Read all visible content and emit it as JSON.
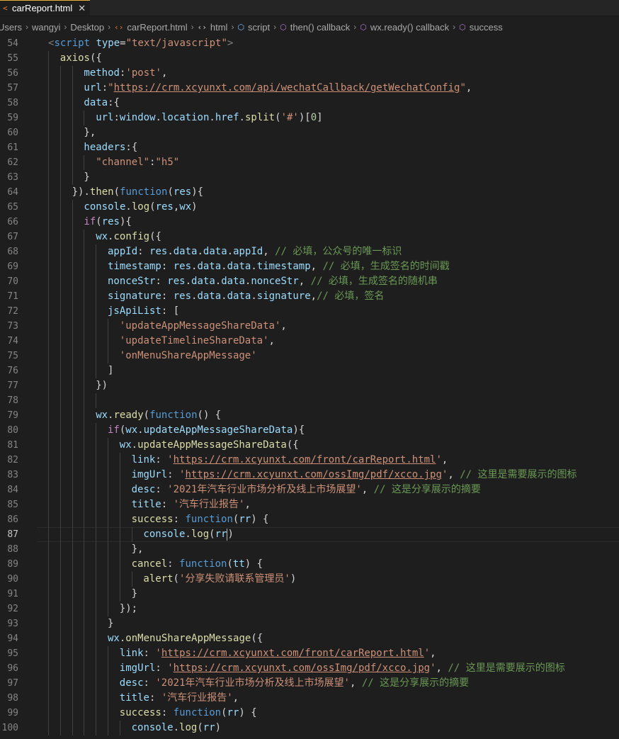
{
  "tab": {
    "title": "carReport.html",
    "icon": "html-file-icon",
    "close": "✕"
  },
  "breadcrumb": [
    {
      "label": "Users",
      "icon": null
    },
    {
      "label": "wangyi",
      "icon": null
    },
    {
      "label": "Desktop",
      "icon": null
    },
    {
      "label": "carReport.html",
      "icon": "html-file-icon"
    },
    {
      "label": "html",
      "icon": "tag-icon"
    },
    {
      "label": "script",
      "icon": "symbol-cube-icon"
    },
    {
      "label": "then() callback",
      "icon": "symbol-method-icon"
    },
    {
      "label": "wx.ready() callback",
      "icon": "symbol-method-icon"
    },
    {
      "label": "success",
      "icon": "symbol-method-icon"
    }
  ],
  "editor": {
    "active_line": 87,
    "lines": [
      {
        "n": 54,
        "indent": 1,
        "tokens": [
          [
            "tagp",
            "<"
          ],
          [
            "tag",
            "script"
          ],
          [
            "pun",
            " "
          ],
          [
            "attr",
            "type"
          ],
          [
            "pun",
            "="
          ],
          [
            "str",
            "\"text/javascript\""
          ],
          [
            "tagp",
            ">"
          ]
        ]
      },
      {
        "n": 55,
        "indent": 2,
        "tokens": [
          [
            "fn",
            "axios"
          ],
          [
            "pun",
            "({"
          ]
        ]
      },
      {
        "n": 56,
        "indent": 4,
        "tokens": [
          [
            "var",
            "method"
          ],
          [
            "pun",
            ":"
          ],
          [
            "str",
            "'post'"
          ],
          [
            "pun",
            ","
          ]
        ]
      },
      {
        "n": 57,
        "indent": 4,
        "tokens": [
          [
            "var",
            "url"
          ],
          [
            "pun",
            ":"
          ],
          [
            "str",
            "\""
          ],
          [
            "url",
            "https://crm.xcyunxt.com/api/wechatCallback/getWechatConfig"
          ],
          [
            "str",
            "\""
          ],
          [
            "pun",
            ","
          ]
        ]
      },
      {
        "n": 58,
        "indent": 4,
        "tokens": [
          [
            "var",
            "data"
          ],
          [
            "pun",
            ":{"
          ]
        ]
      },
      {
        "n": 59,
        "indent": 5,
        "tokens": [
          [
            "var",
            "url"
          ],
          [
            "pun",
            ":"
          ],
          [
            "var",
            "window"
          ],
          [
            "pun",
            "."
          ],
          [
            "var",
            "location"
          ],
          [
            "pun",
            "."
          ],
          [
            "var",
            "href"
          ],
          [
            "pun",
            "."
          ],
          [
            "fn",
            "split"
          ],
          [
            "pun",
            "("
          ],
          [
            "str",
            "'#'"
          ],
          [
            "pun",
            ")["
          ],
          [
            "num",
            "0"
          ],
          [
            "pun",
            "]"
          ]
        ]
      },
      {
        "n": 60,
        "indent": 4,
        "tokens": [
          [
            "pun",
            "},"
          ]
        ]
      },
      {
        "n": 61,
        "indent": 4,
        "tokens": [
          [
            "var",
            "headers"
          ],
          [
            "pun",
            ":{"
          ]
        ]
      },
      {
        "n": 62,
        "indent": 5,
        "tokens": [
          [
            "str",
            "\"channel\""
          ],
          [
            "pun",
            ":"
          ],
          [
            "str",
            "\"h5\""
          ]
        ]
      },
      {
        "n": 63,
        "indent": 4,
        "tokens": [
          [
            "pun",
            "}"
          ]
        ]
      },
      {
        "n": 64,
        "indent": 3,
        "tokens": [
          [
            "pun",
            "})."
          ],
          [
            "fn",
            "then"
          ],
          [
            "pun",
            "("
          ],
          [
            "kw",
            "function"
          ],
          [
            "pun",
            "("
          ],
          [
            "var",
            "res"
          ],
          [
            "pun",
            "){"
          ]
        ]
      },
      {
        "n": 65,
        "indent": 4,
        "tokens": [
          [
            "var",
            "console"
          ],
          [
            "pun",
            "."
          ],
          [
            "fn",
            "log"
          ],
          [
            "pun",
            "("
          ],
          [
            "var",
            "res"
          ],
          [
            "pun",
            ","
          ],
          [
            "var",
            "wx"
          ],
          [
            "pun",
            ")"
          ]
        ]
      },
      {
        "n": 66,
        "indent": 4,
        "tokens": [
          [
            "ctrl",
            "if"
          ],
          [
            "pun",
            "("
          ],
          [
            "var",
            "res"
          ],
          [
            "pun",
            "){"
          ]
        ]
      },
      {
        "n": 67,
        "indent": 5,
        "tokens": [
          [
            "var",
            "wx"
          ],
          [
            "pun",
            "."
          ],
          [
            "fn",
            "config"
          ],
          [
            "pun",
            "({"
          ]
        ]
      },
      {
        "n": 68,
        "indent": 6,
        "tokens": [
          [
            "var",
            "appId"
          ],
          [
            "pun",
            ": "
          ],
          [
            "var",
            "res"
          ],
          [
            "pun",
            "."
          ],
          [
            "var",
            "data"
          ],
          [
            "pun",
            "."
          ],
          [
            "var",
            "data"
          ],
          [
            "pun",
            "."
          ],
          [
            "var",
            "appId"
          ],
          [
            "pun",
            ", "
          ],
          [
            "cmt",
            "// 必填，公众号的唯一标识"
          ]
        ]
      },
      {
        "n": 69,
        "indent": 6,
        "tokens": [
          [
            "var",
            "timestamp"
          ],
          [
            "pun",
            ": "
          ],
          [
            "var",
            "res"
          ],
          [
            "pun",
            "."
          ],
          [
            "var",
            "data"
          ],
          [
            "pun",
            "."
          ],
          [
            "var",
            "data"
          ],
          [
            "pun",
            "."
          ],
          [
            "var",
            "timestamp"
          ],
          [
            "pun",
            ", "
          ],
          [
            "cmt",
            "// 必填，生成签名的时间戳"
          ]
        ]
      },
      {
        "n": 70,
        "indent": 6,
        "tokens": [
          [
            "var",
            "nonceStr"
          ],
          [
            "pun",
            ": "
          ],
          [
            "var",
            "res"
          ],
          [
            "pun",
            "."
          ],
          [
            "var",
            "data"
          ],
          [
            "pun",
            "."
          ],
          [
            "var",
            "data"
          ],
          [
            "pun",
            "."
          ],
          [
            "var",
            "nonceStr"
          ],
          [
            "pun",
            ", "
          ],
          [
            "cmt",
            "// 必填，生成签名的随机串"
          ]
        ]
      },
      {
        "n": 71,
        "indent": 6,
        "tokens": [
          [
            "var",
            "signature"
          ],
          [
            "pun",
            ": "
          ],
          [
            "var",
            "res"
          ],
          [
            "pun",
            "."
          ],
          [
            "var",
            "data"
          ],
          [
            "pun",
            "."
          ],
          [
            "var",
            "data"
          ],
          [
            "pun",
            "."
          ],
          [
            "var",
            "signature"
          ],
          [
            "pun",
            ","
          ],
          [
            "cmt",
            "// 必填，签名"
          ]
        ]
      },
      {
        "n": 72,
        "indent": 6,
        "tokens": [
          [
            "var",
            "jsApiList"
          ],
          [
            "pun",
            ": ["
          ]
        ]
      },
      {
        "n": 73,
        "indent": 7,
        "tokens": [
          [
            "str",
            "'updateAppMessageShareData'"
          ],
          [
            "pun",
            ","
          ]
        ]
      },
      {
        "n": 74,
        "indent": 7,
        "tokens": [
          [
            "str",
            "'updateTimelineShareData'"
          ],
          [
            "pun",
            ","
          ]
        ]
      },
      {
        "n": 75,
        "indent": 7,
        "tokens": [
          [
            "str",
            "'onMenuShareAppMessage'"
          ]
        ]
      },
      {
        "n": 76,
        "indent": 6,
        "tokens": [
          [
            "pun",
            "]"
          ]
        ]
      },
      {
        "n": 77,
        "indent": 5,
        "tokens": [
          [
            "pun",
            "})"
          ]
        ]
      },
      {
        "n": 78,
        "indent": 0,
        "tokens": []
      },
      {
        "n": 79,
        "indent": 5,
        "tokens": [
          [
            "var",
            "wx"
          ],
          [
            "pun",
            "."
          ],
          [
            "fn",
            "ready"
          ],
          [
            "pun",
            "("
          ],
          [
            "kw",
            "function"
          ],
          [
            "pun",
            "() {"
          ]
        ]
      },
      {
        "n": 80,
        "indent": 6,
        "tokens": [
          [
            "ctrl",
            "if"
          ],
          [
            "pun",
            "("
          ],
          [
            "var",
            "wx"
          ],
          [
            "pun",
            "."
          ],
          [
            "var",
            "updateAppMessageShareData"
          ],
          [
            "pun",
            "){"
          ]
        ]
      },
      {
        "n": 81,
        "indent": 7,
        "tokens": [
          [
            "var",
            "wx"
          ],
          [
            "pun",
            "."
          ],
          [
            "fn",
            "updateAppMessageShareData"
          ],
          [
            "pun",
            "({"
          ]
        ]
      },
      {
        "n": 82,
        "indent": 8,
        "tokens": [
          [
            "var",
            "link"
          ],
          [
            "pun",
            ": "
          ],
          [
            "str",
            "'"
          ],
          [
            "url",
            "https://crm.xcyunxt.com/front/carReport.html"
          ],
          [
            "str",
            "'"
          ],
          [
            "pun",
            ","
          ]
        ]
      },
      {
        "n": 83,
        "indent": 8,
        "tokens": [
          [
            "var",
            "imgUrl"
          ],
          [
            "pun",
            ": "
          ],
          [
            "str",
            "'"
          ],
          [
            "url",
            "https://crm.xcyunxt.com/ossImg/pdf/xcco.jpg"
          ],
          [
            "str",
            "'"
          ],
          [
            "pun",
            ", "
          ],
          [
            "cmt",
            "// 这里是需要展示的图标"
          ]
        ]
      },
      {
        "n": 84,
        "indent": 8,
        "tokens": [
          [
            "var",
            "desc"
          ],
          [
            "pun",
            ": "
          ],
          [
            "str",
            "'2021年汽车行业市场分析及线上市场展望'"
          ],
          [
            "pun",
            ", "
          ],
          [
            "cmt",
            "// 这是分享展示的摘要"
          ]
        ]
      },
      {
        "n": 85,
        "indent": 8,
        "tokens": [
          [
            "var",
            "title"
          ],
          [
            "pun",
            ": "
          ],
          [
            "str",
            "'汽车行业报告'"
          ],
          [
            "pun",
            ","
          ]
        ]
      },
      {
        "n": 86,
        "indent": 8,
        "tokens": [
          [
            "fn",
            "success"
          ],
          [
            "pun",
            ": "
          ],
          [
            "kw",
            "function"
          ],
          [
            "pun",
            "("
          ],
          [
            "var",
            "rr"
          ],
          [
            "pun",
            ") {"
          ]
        ]
      },
      {
        "n": 87,
        "indent": 9,
        "tokens": [
          [
            "var",
            "console"
          ],
          [
            "pun",
            "."
          ],
          [
            "fn",
            "log"
          ],
          [
            "pun",
            "("
          ],
          [
            "var",
            "rr"
          ],
          [
            "pun",
            ")"
          ]
        ]
      },
      {
        "n": 88,
        "indent": 8,
        "tokens": [
          [
            "pun",
            "},"
          ]
        ]
      },
      {
        "n": 89,
        "indent": 8,
        "tokens": [
          [
            "fn",
            "cancel"
          ],
          [
            "pun",
            ": "
          ],
          [
            "kw",
            "function"
          ],
          [
            "pun",
            "("
          ],
          [
            "var",
            "tt"
          ],
          [
            "pun",
            ") {"
          ]
        ]
      },
      {
        "n": 90,
        "indent": 9,
        "tokens": [
          [
            "fn",
            "alert"
          ],
          [
            "pun",
            "("
          ],
          [
            "str",
            "'分享失败请联系管理员'"
          ],
          [
            "pun",
            ")"
          ]
        ]
      },
      {
        "n": 91,
        "indent": 8,
        "tokens": [
          [
            "pun",
            "}"
          ]
        ]
      },
      {
        "n": 92,
        "indent": 7,
        "tokens": [
          [
            "pun",
            "});"
          ]
        ]
      },
      {
        "n": 93,
        "indent": 6,
        "tokens": [
          [
            "pun",
            "}"
          ]
        ]
      },
      {
        "n": 94,
        "indent": 6,
        "tokens": [
          [
            "var",
            "wx"
          ],
          [
            "pun",
            "."
          ],
          [
            "fn",
            "onMenuShareAppMessage"
          ],
          [
            "pun",
            "({"
          ]
        ]
      },
      {
        "n": 95,
        "indent": 7,
        "tokens": [
          [
            "var",
            "link"
          ],
          [
            "pun",
            ": "
          ],
          [
            "str",
            "'"
          ],
          [
            "url",
            "https://crm.xcyunxt.com/front/carReport.html"
          ],
          [
            "str",
            "'"
          ],
          [
            "pun",
            ","
          ]
        ]
      },
      {
        "n": 96,
        "indent": 7,
        "tokens": [
          [
            "var",
            "imgUrl"
          ],
          [
            "pun",
            ": "
          ],
          [
            "str",
            "'"
          ],
          [
            "url",
            "https://crm.xcyunxt.com/ossImg/pdf/xcco.jpg"
          ],
          [
            "str",
            "'"
          ],
          [
            "pun",
            ", "
          ],
          [
            "cmt",
            "// 这里是需要展示的图标"
          ]
        ]
      },
      {
        "n": 97,
        "indent": 7,
        "tokens": [
          [
            "var",
            "desc"
          ],
          [
            "pun",
            ": "
          ],
          [
            "str",
            "'2021年汽车行业市场分析及线上市场展望'"
          ],
          [
            "pun",
            ", "
          ],
          [
            "cmt",
            "// 这是分享展示的摘要"
          ]
        ]
      },
      {
        "n": 98,
        "indent": 7,
        "tokens": [
          [
            "var",
            "title"
          ],
          [
            "pun",
            ": "
          ],
          [
            "str",
            "'汽车行业报告'"
          ],
          [
            "pun",
            ","
          ]
        ]
      },
      {
        "n": 99,
        "indent": 7,
        "tokens": [
          [
            "fn",
            "success"
          ],
          [
            "pun",
            ": "
          ],
          [
            "kw",
            "function"
          ],
          [
            "pun",
            "("
          ],
          [
            "var",
            "rr"
          ],
          [
            "pun",
            ") {"
          ]
        ]
      },
      {
        "n": 100,
        "indent": 8,
        "tokens": [
          [
            "var",
            "console"
          ],
          [
            "pun",
            "."
          ],
          [
            "fn",
            "log"
          ],
          [
            "pun",
            "("
          ],
          [
            "var",
            "rr"
          ],
          [
            "pun",
            ")"
          ]
        ]
      }
    ]
  }
}
